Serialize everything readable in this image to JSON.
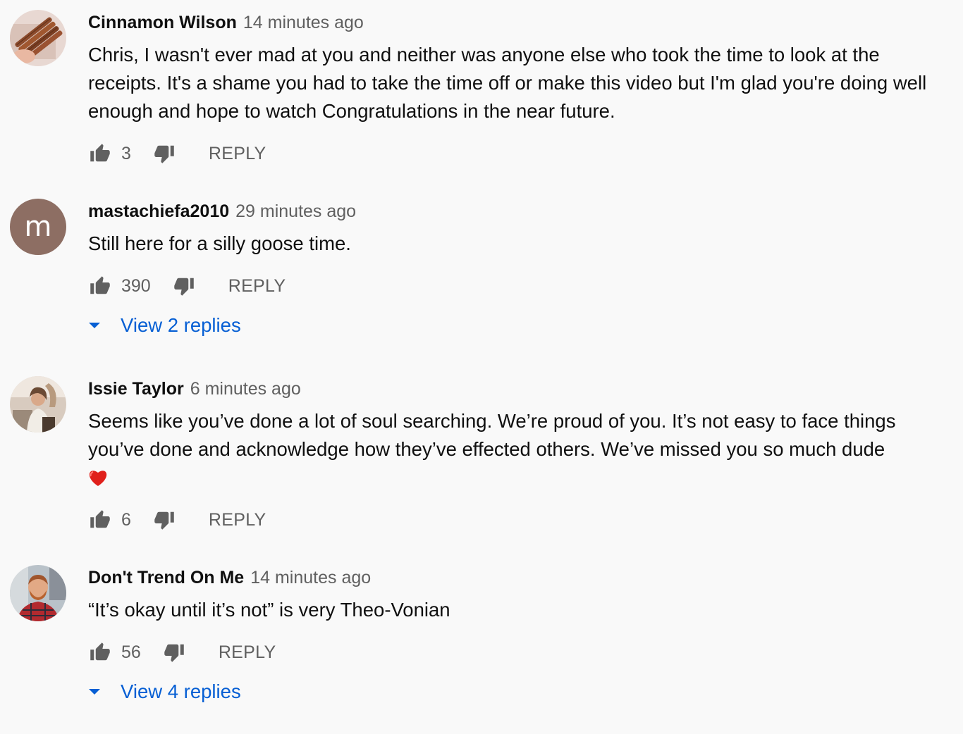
{
  "colors": {
    "background": "#f9f9f9",
    "author": "#0f0f0f",
    "muted": "#606060",
    "link": "#065fd4",
    "letter_avatar": "#8d6e63"
  },
  "comments": [
    {
      "author": "Cinnamon Wilson",
      "time": "14 minutes ago",
      "avatar": {
        "type": "image",
        "icon": "cinnamon-sticks-photo"
      },
      "text": "Chris,  I wasn't ever mad at you and neither was anyone else who took the time to look at the receipts.  It's a shame you had to take the time off or make this video but I'm glad you're doing well enough and hope to watch Congratulations in the near future.",
      "likes": "3",
      "reply_label": "REPLY"
    },
    {
      "author": "mastachiefa2010",
      "time": "29 minutes ago",
      "avatar": {
        "type": "letter",
        "letter": "m"
      },
      "text": "Still here for a silly goose time.",
      "likes": "390",
      "reply_label": "REPLY",
      "view_replies": "View 2 replies"
    },
    {
      "author": "Issie Taylor",
      "time": "6 minutes ago",
      "avatar": {
        "type": "image",
        "icon": "woman-portrait-photo"
      },
      "text": "Seems like you’ve done a lot of soul searching. We’re proud of you. It’s not easy to face things you’ve done and acknowledge how they’ve effected others. We’ve missed you so much dude",
      "emoji": "red-heart-icon",
      "likes": "6",
      "reply_label": "REPLY"
    },
    {
      "author": "Don't Trend On Me",
      "time": "14 minutes ago",
      "avatar": {
        "type": "image",
        "icon": "man-portrait-photo"
      },
      "text": "“It’s okay until it’s not” is very Theo-Vonian",
      "likes": "56",
      "reply_label": "REPLY",
      "view_replies": "View 4 replies"
    }
  ]
}
